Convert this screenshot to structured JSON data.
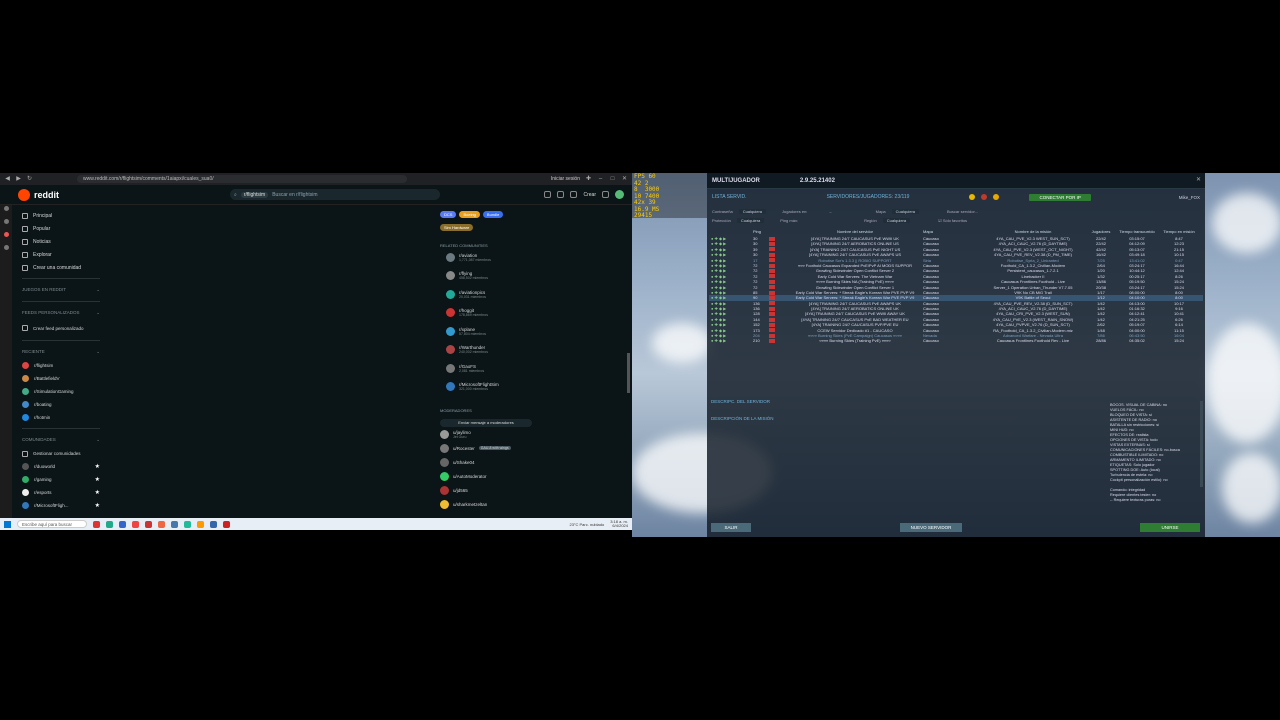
{
  "browser": {
    "url": "www.reddit.com/r/flightsim/comments/1aiapxi/cuales_sua0/",
    "right_text": "Iniciar sesión"
  },
  "reddit": {
    "logo_text": "reddit",
    "search_chip": "r/flightsim",
    "search_placeholder": "Buscar en r/flightsim",
    "create_label": "Crear",
    "nav": [
      "Principal",
      "Popular",
      "Noticias",
      "Explorar",
      "Crear una comunidad"
    ],
    "sections": {
      "games": "JUEGOS EN REDDIT",
      "custom_feeds": "FEEDS PERSONALIZADOS",
      "create_feed": "Crear feed personalizado",
      "recent": "RECIENTE",
      "communities": "COMUNIDADES",
      "manage": "Gestionar comunidades"
    },
    "recent": [
      "r/flightsim",
      "r/BattlefieldV",
      "r/SimulationGaming",
      "r/boating",
      "r/hotmin"
    ],
    "communities": [
      "r/duoworld",
      "r/gaming",
      "r/esports",
      "r/MicrosoftFligh..."
    ],
    "flairs": [
      "DCS",
      "Boeing",
      "Bundle"
    ],
    "flair_second": "Sim Hardware",
    "related_heading": "RELATED COMMUNITIES",
    "related": [
      {
        "name": "r/aviation",
        "sub": "1,771,087 miembros"
      },
      {
        "name": "r/flying",
        "sub": "458,502 miembros"
      },
      {
        "name": "r/aviationpics",
        "sub": "20,031 miembros"
      },
      {
        "name": "r/hoggit",
        "sub": "178,869 miembros"
      },
      {
        "name": "r/xplane",
        "sub": "57,804 miembros"
      },
      {
        "name": "r/Warthunder",
        "sub": "240,002 miembros"
      },
      {
        "name": "r/GaoFS",
        "sub": "2,081 miembros"
      },
      {
        "name": "r/MicrosoftFlightSim",
        "sub": "321,000 miembros"
      }
    ],
    "mods_heading": "MODERADORES",
    "message_mods": "Enviar mensaje a moderadores",
    "mods": [
      {
        "name": "u/jaylimo",
        "sub": "Jet Guru",
        "flair": ""
      },
      {
        "name": "u/Rocester",
        "sub": "",
        "flair": "GAU-8 with wings"
      },
      {
        "name": "u/Shake04",
        "sub": "",
        "flair": ""
      },
      {
        "name": "u/AutoModerator",
        "sub": "",
        "flair": ""
      },
      {
        "name": "u/jd565",
        "sub": "",
        "flair": ""
      },
      {
        "name": "u/sharkmetzeltan",
        "sub": "",
        "flair": ""
      }
    ]
  },
  "taskbar": {
    "search": "Escribe aquí para buscar",
    "weather": "23°C  Parc. nublado",
    "time": "3:18 a. m.",
    "date": "6/4/2024"
  },
  "game": {
    "hud": "FPS 60\n42 2\n8  3000\n10 7400\n42x 39\n16.9 MS\n29415",
    "title": "MULTIJUGADOR",
    "version": "2.9.25.21402",
    "tab_list": "LISTA SERVID.",
    "tab_servers": "SERVIDORES/JUGADORES: 23/119",
    "connect_ip": "CONECTAR POR IP",
    "player_name": "Mike_FOX",
    "filters": {
      "mode_label": "Contraseña",
      "mode_value": "Cualquiera",
      "players_label": "Jugadores en:",
      "map_label": "Mapa",
      "map_value": "Cualquiera",
      "search_label": "Buscar servidor...",
      "protection_label": "Protección",
      "protection_value": "Cualquiera",
      "ping_label": "Ping máx:",
      "region_label": "Región",
      "region_value": "Cualquiera",
      "favorites_label": "Sólo favoritos"
    },
    "columns": {
      "ping": "Ping",
      "name": "Nombre del servidor",
      "map": "Mapa",
      "mission": "Nombre de la misión",
      "players": "Jugadores",
      "time": "Tiempo transcurrido",
      "time2": "Tiempo en misión"
    },
    "servers": [
      {
        "ping": "30",
        "name": "[4YA] TRAINING 24/7 CAUCASUS PvE WWII UK",
        "map": "Cáucaso",
        "mission": "4YA_CAU_PVE_V2.3 WEST_SUN_SCT)",
        "players": "22/42",
        "time": "03:15:07",
        "time2": "8:47",
        "state": "normal"
      },
      {
        "ping": "30",
        "name": "[4YA] TRAINING 24/7 AEROBATICS ONLINE US",
        "map": "Cáucaso",
        "mission": "4YA_ACI_CAUC_V2.76 (D_DAYTIME)",
        "players": "22/42",
        "time": "04:12:09",
        "time2": "12:23",
        "state": "normal"
      },
      {
        "ping": "39",
        "name": "[4YA] TRAINING 24/7 CAUCASUS PvE NIGHT US",
        "map": "Cáucaso",
        "mission": "4YA_CAU_PVE_V2.3 (WEST_OCT_NIGHT)",
        "players": "42/42",
        "time": "05:13:07",
        "time2": "21:15",
        "state": "normal"
      },
      {
        "ping": "30",
        "name": "[4YA] TRAINING 24/7 CAUCASUS PvE AWAPS US",
        "map": "Cáucaso",
        "mission": "4YA_CAU_PVE_REV_V2.38 (D_PM_TIME)",
        "players": "16/42",
        "time": "03:49:18",
        "time2": "10:15",
        "state": "normal"
      },
      {
        "ping": "17",
        "name": "Robotise Scr's 1.3.3 || ROBIO SUPPORT",
        "map": "Siria",
        "mission": "Robotise_Syria_2_Uniranted",
        "players": "7/25",
        "time": "13:41:02",
        "time2": "0:47",
        "state": "dim"
      },
      {
        "ping": "72",
        "name": "¤¤¤ Foothold Caucasus Expanded PvE/PvP AI MODS SUPPOR",
        "map": "Cáucaso",
        "mission": "Foothold_CA_1.3.2_Civilian-Modern",
        "players": "2/64",
        "time": "03:24:17",
        "time2": "16:44",
        "state": "normal"
      },
      {
        "ping": "72",
        "name": "Growling Sidewinder Open Conflict Server 2",
        "map": "Cáucaso",
        "mission": "Persistent_caucasus_1.7.2.1",
        "players": "1/20",
        "time": "10:44:12",
        "time2": "12:44",
        "state": "normal"
      },
      {
        "ping": "72",
        "name": "Early Cold War Servers: The Vietnam War",
        "map": "Cáucaso",
        "mission": "Linebacker II",
        "players": "1/32",
        "time": "00:25:17",
        "time2": "8:26",
        "state": "normal"
      },
      {
        "ping": "72",
        "name": "¤¤¤¤ Burning Skies NA (Training PvE) ¤¤¤¤",
        "map": "Cáucaso",
        "mission": "Caucasus Frontlines Foothold - Live",
        "players": "13/86",
        "time": "05:19:50",
        "time2": "15:24",
        "state": "normal"
      },
      {
        "ping": "72",
        "name": "Growling Sidewinder Open Conflict Server 1",
        "map": "Cáucaso",
        "mission": "Server_1 Operation Urban_Thunder V7.7.05",
        "players": "20/38",
        "time": "03:24:17",
        "time2": "15:24",
        "state": "normal"
      },
      {
        "ping": "85",
        "name": "Early Cold War Servers: * Streak Eagle's Korean War PVE PVP V9",
        "map": "Cáucaso",
        "mission": "V9K No CB MiG Trail",
        "players": "1/17",
        "time": "08:00:00",
        "time2": "8:00",
        "state": "normal"
      },
      {
        "ping": "90",
        "name": "Early Cold War Servers: * Streak Eagle's Korean War PVE PVP V9",
        "map": "Cáucaso",
        "mission": "V9K Battle of Seoul",
        "players": "1/12",
        "time": "04:10:00",
        "time2": "8:00",
        "state": "sel"
      },
      {
        "ping": "136",
        "name": "[4YA] TRAINING 24/7 CAUCASUS PvE AWAPS UK",
        "map": "Cáucaso",
        "mission": "4YA_CAU_PVE_REV_V2.38 (D_SUN_SCT)",
        "players": "1/42",
        "time": "04:13:00",
        "time2": "10:17",
        "state": "normal"
      },
      {
        "ping": "136",
        "name": "[4YA] TRAINING 24/7 AEROBATICS ONLINE UK",
        "map": "Cáucaso",
        "mission": "4YA_ACI_CAUC_V2.76 (D_DAYTIME)",
        "players": "1/42",
        "time": "01:16:32",
        "time2": "9:16",
        "state": "normal"
      },
      {
        "ping": "128",
        "name": "[4YA] TRAINING 24/7 CAUCASUS PvE WWII AWAY UK",
        "map": "Cáucaso",
        "mission": "4YA_CAU_CRI_PVE_V2.3 (WEST_SUN)",
        "players": "1/42",
        "time": "04:12:41",
        "time2": "10:41",
        "state": "normal"
      },
      {
        "ping": "144",
        "name": "[4YA] TRAINING 24/7 CAUCASUS PvE BAD WEATHER EU",
        "map": "Cáucaso",
        "mission": "4YA_CAU_PVE_V2.3 (WEST_RAIN_SNOW)",
        "players": "1/42",
        "time": "04:21:25",
        "time2": "6:26",
        "state": "normal"
      },
      {
        "ping": "152",
        "name": "[4YA] TRAINING 24/7 CAUCASUS PVP/PVE EU",
        "map": "Cáucaso",
        "mission": "4YA_CAU_PVPVE_V2.76 (D_SUN_SCT)",
        "players": "2/62",
        "time": "05:19:07",
        "time2": "6:14",
        "state": "normal"
      },
      {
        "ping": "173",
        "name": "CCEW Servidor Dedicado #1 - CAUCASO",
        "map": "Cáucaso",
        "mission": "RA_Foothold_CA_1.3.2_Civilian-Modern.miz",
        "players": "1/48",
        "time": "04:00:00",
        "time2": "11:15",
        "state": "normal"
      },
      {
        "ping": "204",
        "name": "¤¤¤¤ Burning Skies (PvE Campaign) Caucasus ¤¤¤¤",
        "map": "Nevada",
        "mission": "Advanced Warfare - Nevada Ultra",
        "players": "7/86",
        "time": "06:43:50",
        "time2": "16:04",
        "state": "dim"
      },
      {
        "ping": "210",
        "name": "¤¤¤¤ Burning Skies (Training PvE) ¤¤¤¤",
        "map": "Cáucaso",
        "mission": "Caucasus Frontlines Foothold Rev - Live",
        "players": "28/86",
        "time": "04:35:02",
        "time2": "15:24",
        "state": "normal"
      }
    ],
    "desc_server": "DESCRIPC. DEL SERVIDOR",
    "desc_mission": "DESCRIPCIÓN DE LA MISIÓN",
    "settings": [
      "BOCOS. VISUAL DE CABINA: no",
      "VUELOS FÁCIL: no",
      "BLOQUEO DE VISTA: sí",
      "ASISTENTE DE RADIO: no",
      "BATALLA sin restricciones: sí",
      "MINI HUD: no",
      "EFECTOS DE: realista",
      "OPCIONES DE VISTA: todo",
      "VISTAS EXTERNAS: sí",
      "COMUNICACIONES FÁCILES: no-busca",
      "COMBUSTIBLE ILIMITADO: no",
      "ARMAMENTO ILIMITADO: no",
      "ETIQUETAS: Solo jugador",
      "SPOTTING DOE: Auto (local)",
      "Turbulencia de estela: no",
      "Cockpit personalización estilo): no",
      "",
      "Comando: integridad",
      "Requiere clientes tester: no",
      "-- Requiere texturas puras: no"
    ],
    "btn_exit": "SALIR",
    "btn_new": "NUEVO SERVIDOR",
    "btn_join": "UNIRSE"
  }
}
